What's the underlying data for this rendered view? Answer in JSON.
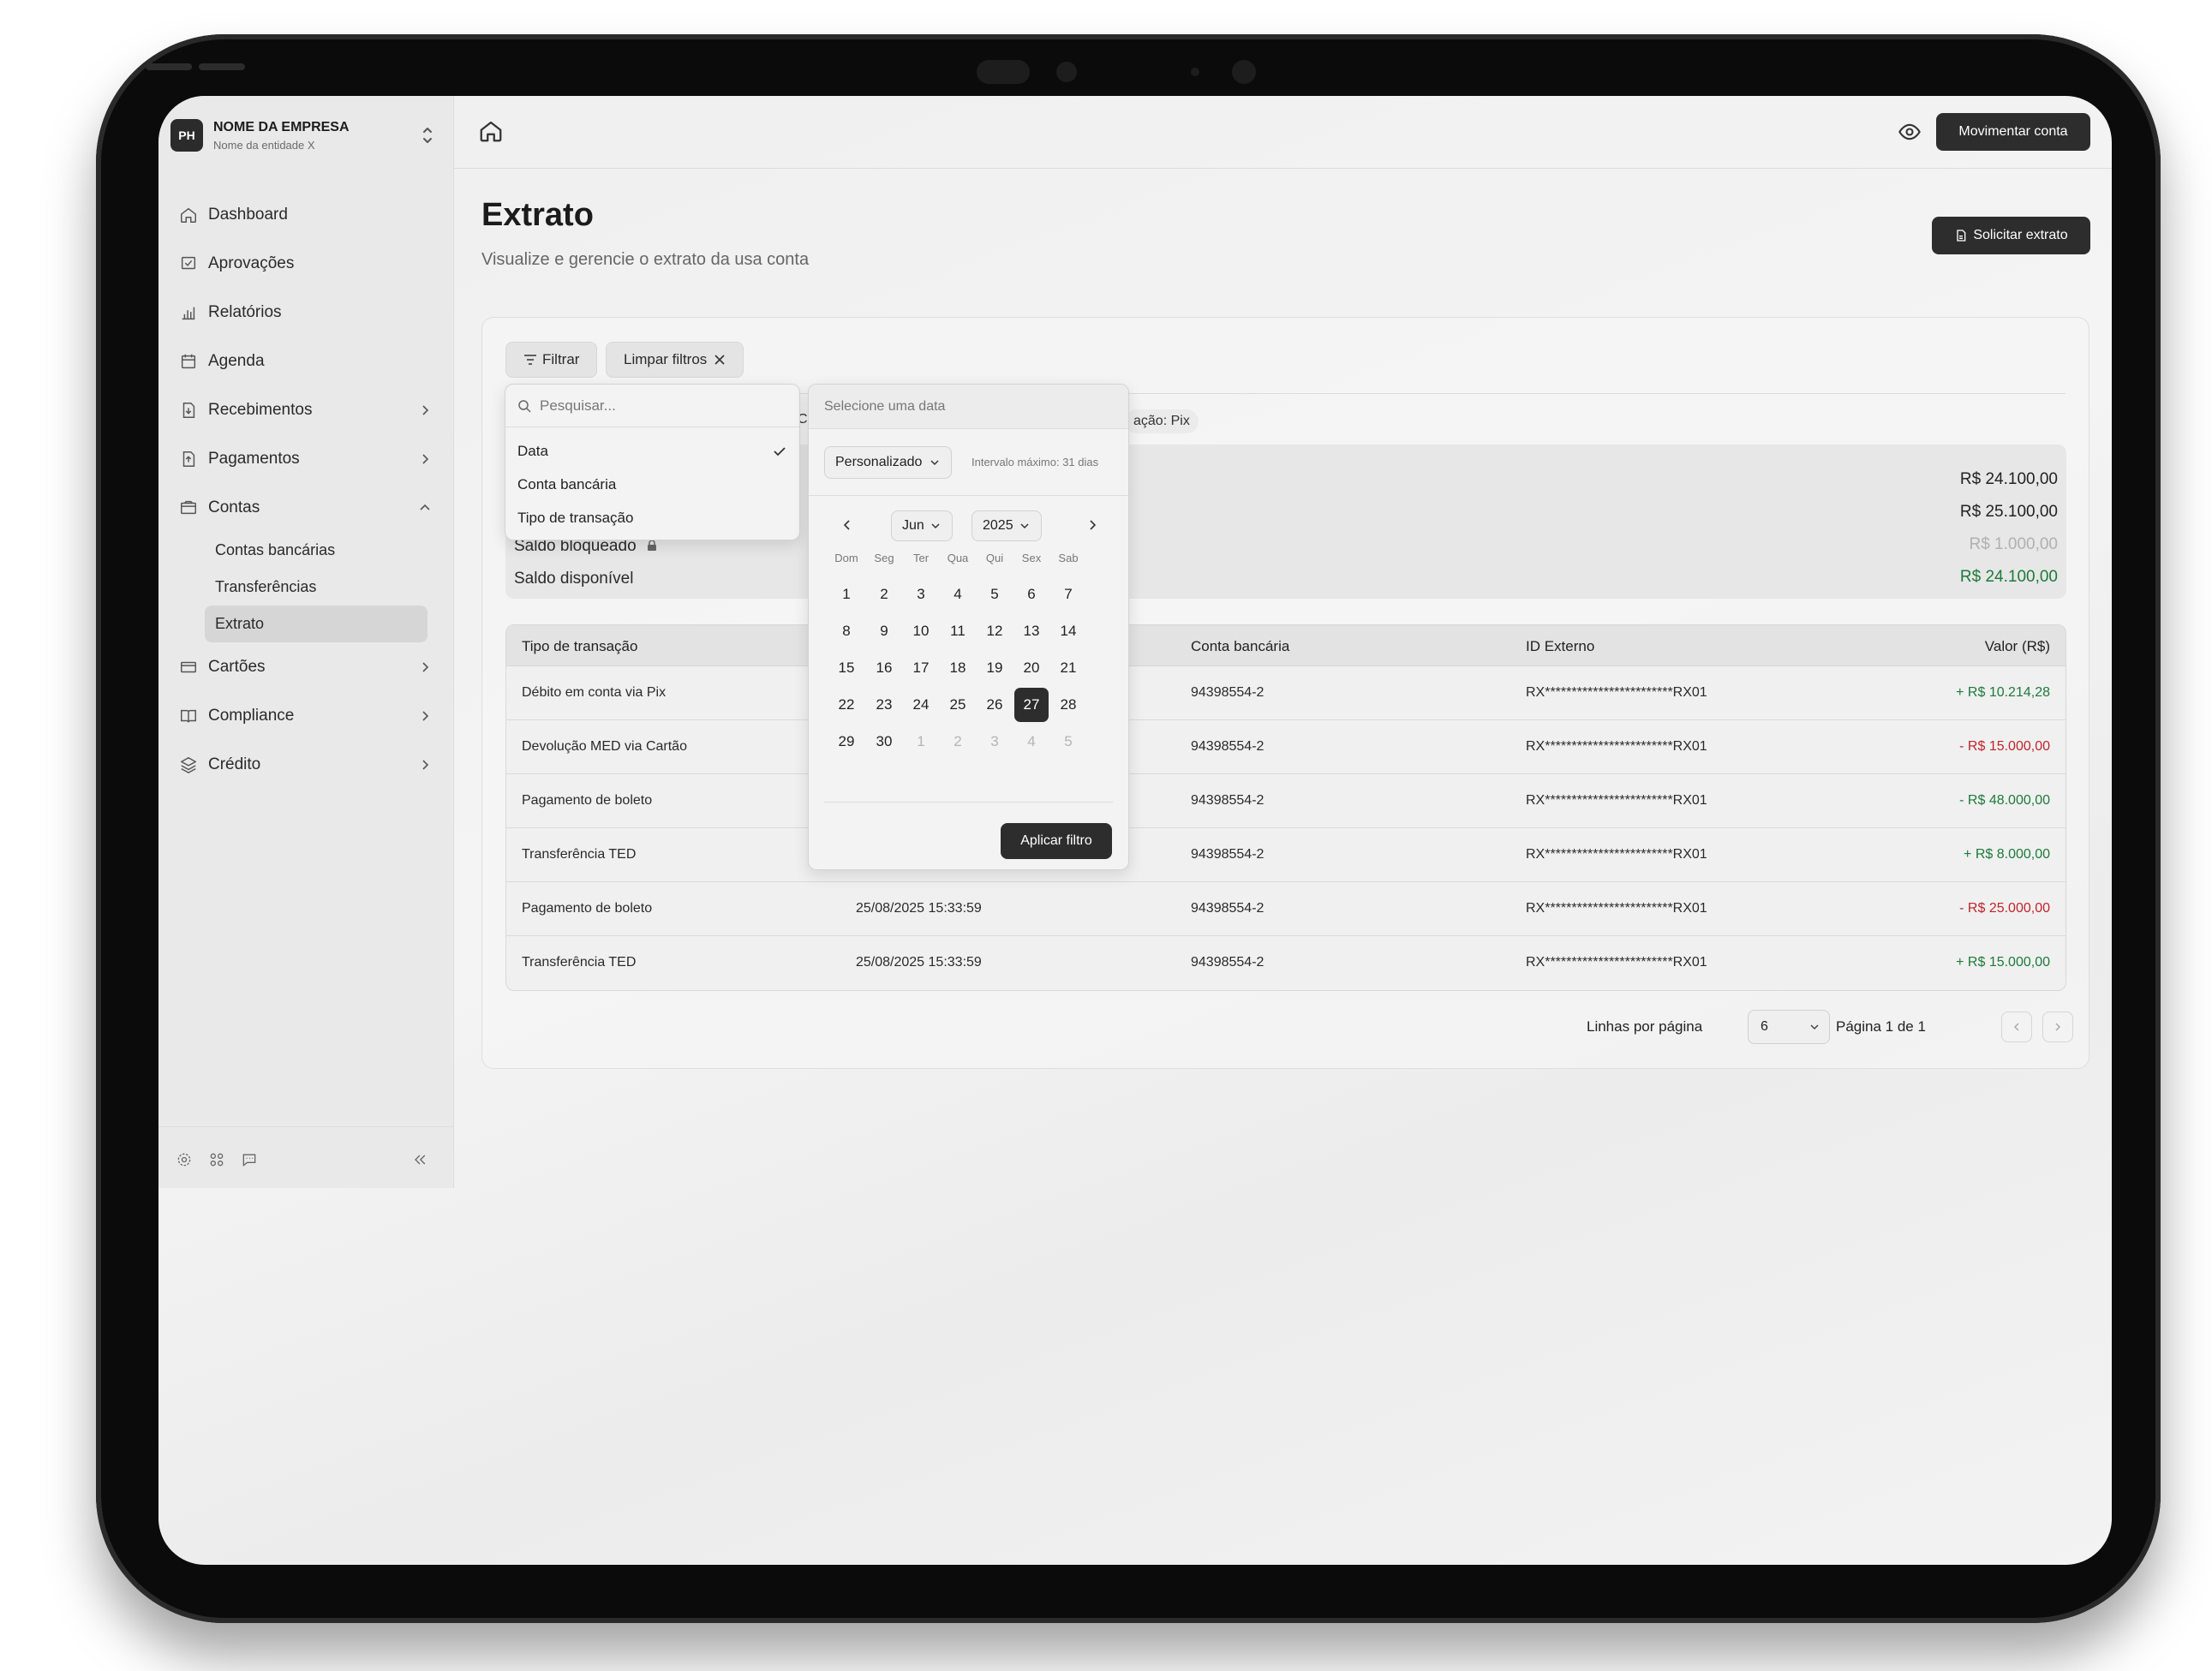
{
  "company": {
    "initials": "PH",
    "name": "NOME DA EMPRESA",
    "entity": "Nome da entidade X"
  },
  "sidebar": {
    "items": [
      {
        "label": "Dashboard",
        "icon": "home-icon"
      },
      {
        "label": "Aprovações",
        "icon": "approval-icon"
      },
      {
        "label": "Relatórios",
        "icon": "bar-chart-icon"
      },
      {
        "label": "Agenda",
        "icon": "calendar-icon"
      },
      {
        "label": "Recebimentos",
        "icon": "document-in-icon"
      },
      {
        "label": "Pagamentos",
        "icon": "document-out-icon"
      },
      {
        "label": "Contas",
        "icon": "wallet-icon"
      },
      {
        "label": "Cartões",
        "icon": "card-icon"
      },
      {
        "label": "Compliance",
        "icon": "book-icon"
      },
      {
        "label": "Crédito",
        "icon": "layers-icon"
      }
    ],
    "contas_sub": [
      "Contas bancárias",
      "Transferências",
      "Extrato"
    ]
  },
  "topbar": {
    "move_button": "Movimentar conta"
  },
  "page": {
    "title": "Extrato",
    "subtitle": "Visualize e gerencie o extrato da usa conta",
    "request_button": "Solicitar extrato"
  },
  "filters": {
    "filter_label": "Filtrar",
    "clear_label": "Limpar filtros",
    "active_tag": "ação: Pix",
    "tag_stub": "C"
  },
  "filter_menu": {
    "search_placeholder": "Pesquisar...",
    "options": [
      "Data",
      "Conta bancária",
      "Tipo de transação"
    ],
    "selected": "Data"
  },
  "summary": {
    "rows": [
      {
        "label": "",
        "value": "R$ 24.100,00",
        "color": "#222222"
      },
      {
        "label": "",
        "value": "R$  25.100,00",
        "color": "#222222"
      },
      {
        "label": "Saldo bloqueado",
        "value": "R$ 1.000,00",
        "color": "#b0b0b0"
      },
      {
        "label": "Saldo disponível",
        "value": "R$ 24.100,00",
        "color": "#1d7a3a"
      }
    ]
  },
  "date_picker": {
    "header": "Selecione uma data",
    "mode": "Personalizado",
    "hint": "Intervalo máximo: 31 dias",
    "month": "Jun",
    "year": "2025",
    "weekdays": [
      "Dom",
      "Seg",
      "Ter",
      "Qua",
      "Qui",
      "Sex",
      "Sab"
    ],
    "weeks": [
      [
        "1",
        "2",
        "3",
        "4",
        "5",
        "6",
        "7"
      ],
      [
        "8",
        "9",
        "10",
        "11",
        "12",
        "13",
        "14"
      ],
      [
        "15",
        "16",
        "17",
        "18",
        "19",
        "20",
        "21"
      ],
      [
        "22",
        "23",
        "24",
        "25",
        "26",
        "27",
        "28"
      ],
      [
        "29",
        "30",
        "1",
        "2",
        "3",
        "4",
        "5"
      ]
    ],
    "selected_day": "27",
    "apply_label": "Aplicar filtro"
  },
  "table": {
    "columns": [
      "Tipo de transação",
      "",
      "Conta bancária",
      "ID Externo",
      "Valor (R$)"
    ],
    "rows": [
      {
        "type": "Débito em conta via Pix",
        "date": "",
        "account": "94398554-2",
        "ext_id": "RX************************RX01",
        "value": "+ R$ 10.214,28",
        "color": "#1d7a3a"
      },
      {
        "type": "Devolução MED via Cartão",
        "date": "",
        "account": "94398554-2",
        "ext_id": "RX************************RX01",
        "value": "- R$ 15.000,00",
        "color": "#c0242c"
      },
      {
        "type": "Pagamento de boleto",
        "date": "",
        "account": "94398554-2",
        "ext_id": "RX************************RX01",
        "value": "- R$ 48.000,00",
        "color": "#1d7a3a"
      },
      {
        "type": "Transferência TED",
        "date": "",
        "account": "94398554-2",
        "ext_id": "RX************************RX01",
        "value": "+ R$ 8.000,00",
        "color": "#1d7a3a"
      },
      {
        "type": "Pagamento de boleto",
        "date": "25/08/2025 15:33:59",
        "account": "94398554-2",
        "ext_id": "RX************************RX01",
        "value": "- R$ 25.000,00",
        "color": "#c0242c"
      },
      {
        "type": "Transferência TED",
        "date": "25/08/2025 15:33:59",
        "account": "94398554-2",
        "ext_id": "RX************************RX01",
        "value": "+ R$ 15.000,00",
        "color": "#1d7a3a"
      }
    ]
  },
  "pagination": {
    "rows_label": "Linhas por página",
    "rows_value": "6",
    "page_label": "Página 1 de 1"
  }
}
